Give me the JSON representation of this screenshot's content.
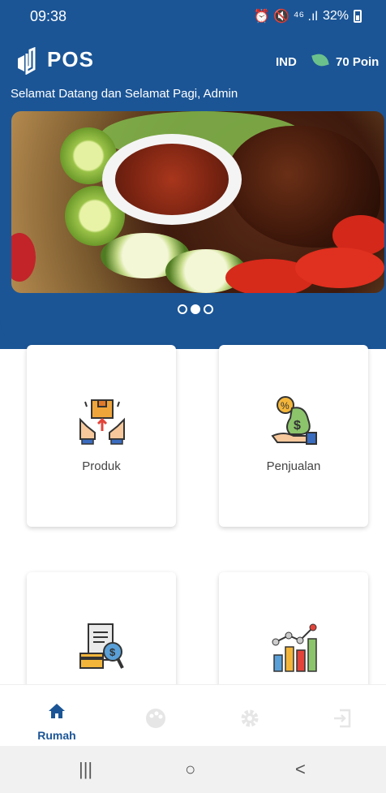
{
  "status_bar": {
    "time": "09:38",
    "icons_text": "⏰ 🔇 ⁴⁶ .ıl",
    "battery": "32%"
  },
  "app_bar": {
    "title": "POS",
    "language": "IND",
    "points": "70 Poin",
    "brand_color": "#1b5596"
  },
  "greeting": "Selamat Datang dan Selamat Pagi, Admin",
  "banner": {
    "slides": 3,
    "active_slide": 2
  },
  "menu": [
    {
      "label": "Produk",
      "icon": "products-hands-box-icon"
    },
    {
      "label": "Penjualan",
      "icon": "money-bag-discount-icon"
    },
    {
      "label": "",
      "icon": "receipt-invoice-icon"
    },
    {
      "label": "",
      "icon": "bar-chart-growth-icon"
    }
  ],
  "bottom_nav": {
    "items": [
      {
        "label": "Rumah",
        "icon": "home-icon",
        "active": true
      },
      {
        "label": "",
        "icon": "palette-icon",
        "active": false
      },
      {
        "label": "",
        "icon": "gear-icon",
        "active": false
      },
      {
        "label": "",
        "icon": "logout-icon",
        "active": false
      }
    ]
  },
  "system_nav": {
    "recent": "|||",
    "home": "○",
    "back": "<"
  }
}
